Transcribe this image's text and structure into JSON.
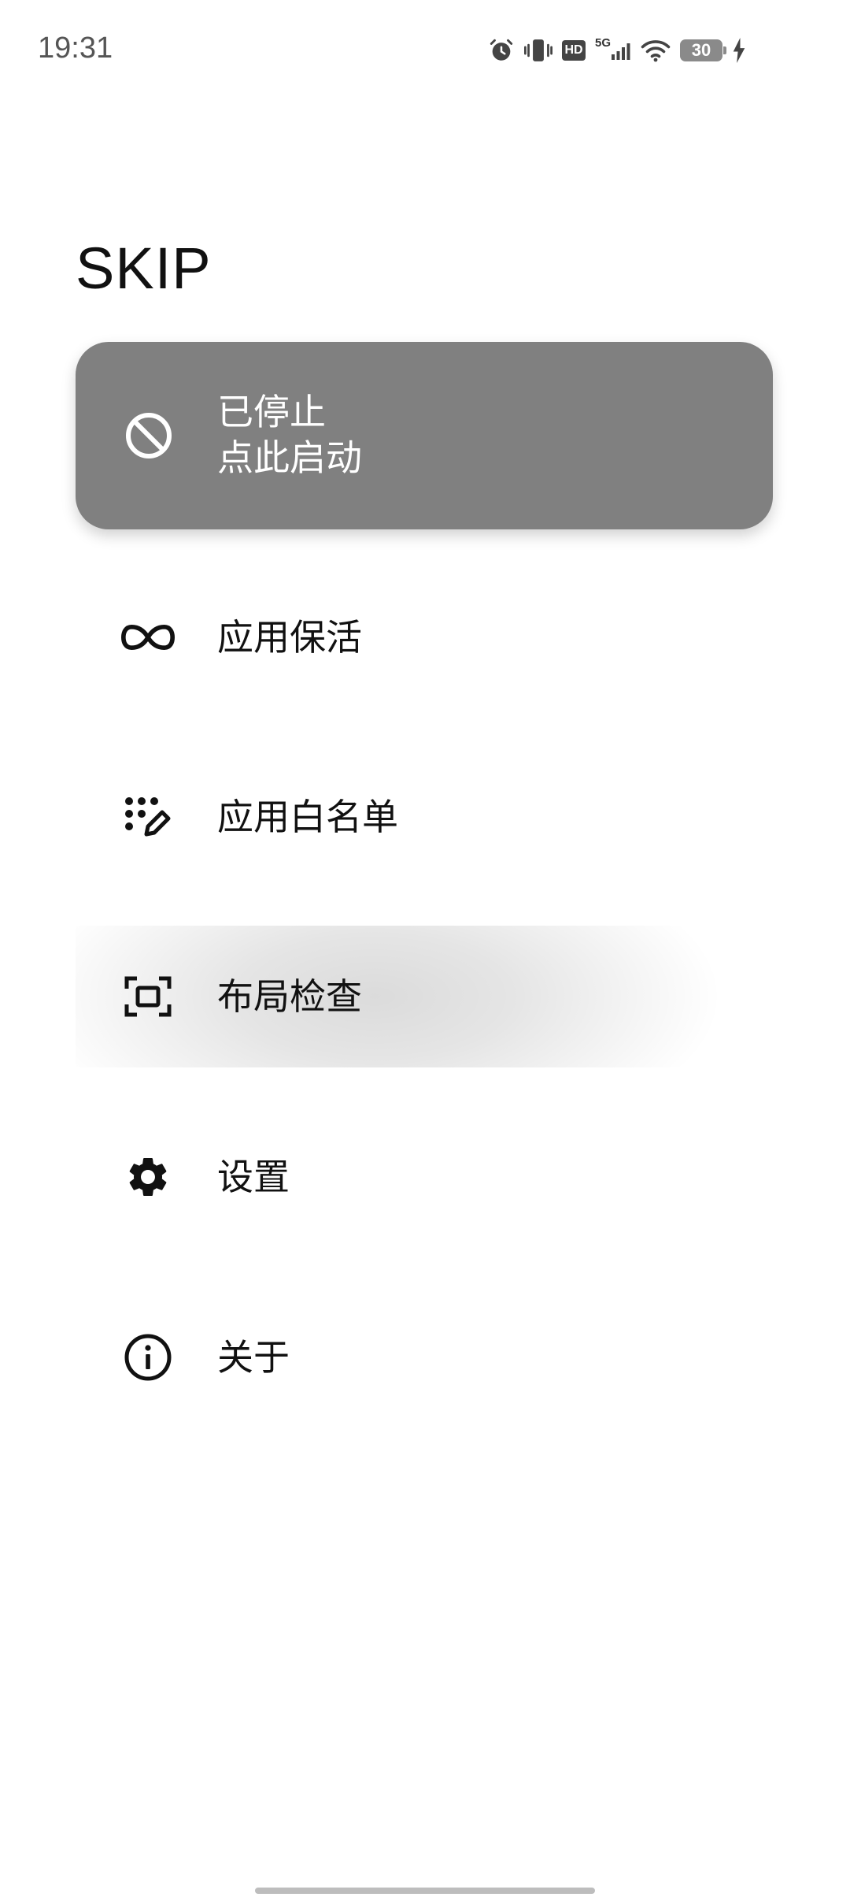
{
  "status_bar": {
    "time": "19:31",
    "hd": "HD",
    "network": "5G",
    "battery": "30"
  },
  "app": {
    "title": "SKIP"
  },
  "status_card": {
    "line1": "已停止",
    "line2": "点此启动",
    "icon": "block-icon"
  },
  "menu": {
    "items": [
      {
        "label": "应用保活",
        "icon": "infinity-icon"
      },
      {
        "label": "应用白名单",
        "icon": "dots-edit-icon"
      },
      {
        "label": "布局检查",
        "icon": "fullscreen-frame-icon"
      },
      {
        "label": "设置",
        "icon": "gear-icon"
      },
      {
        "label": "关于",
        "icon": "info-icon"
      }
    ]
  }
}
